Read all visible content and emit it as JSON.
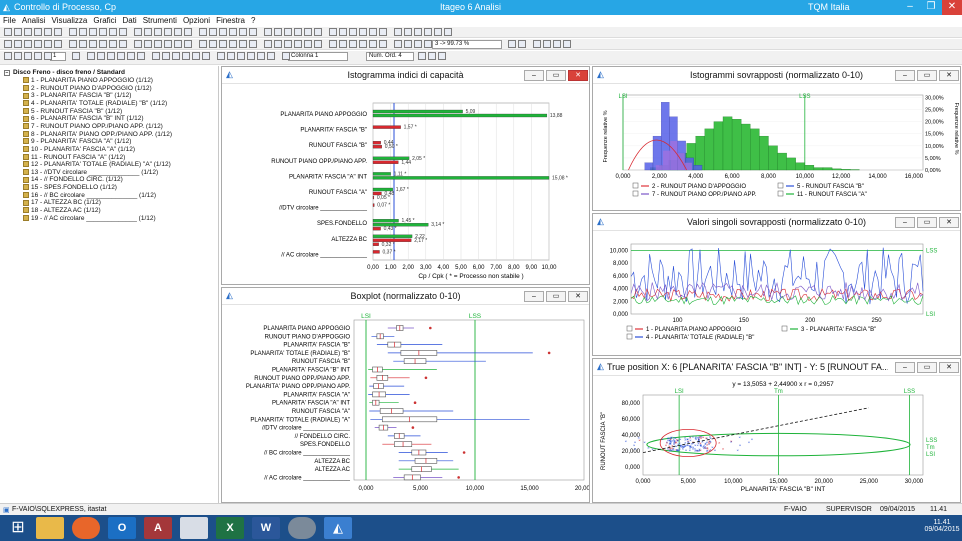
{
  "app": {
    "title_left": "Controllo di Processo, Cp",
    "title_center": "Itageo 6 Analisi",
    "title_right": "TQM Italia"
  },
  "menu": [
    "File",
    "Analisi",
    "Visualizza",
    "Grafici",
    "Dati",
    "Strumenti",
    "Opzioni",
    "Finestra",
    "?"
  ],
  "toolbar": {
    "combo_left": "1",
    "combo_colonna": "Colonna 1",
    "combo_num": "Num. Ord. 4",
    "combo_zoom": "3 -> 99.73 %"
  },
  "tree": {
    "root": "Disco Freno - disco freno / Standard",
    "items": [
      "1 - PLANARITA PIANO APPOGGIO (1/12)",
      "2 - RUNOUT PIANO D'APPOGGIO (1/12)",
      "3 - PLANARITA' FASCIA \"B\" (1/12)",
      "4 - PLANARITA' TOTALE (RADIALE) \"B\" (1/12)",
      "5 - RUNOUT FASCIA \"B\" (1/12)",
      "6 - PLANARITA' FASCIA \"B\" INT (1/12)",
      "7 - RUNOUT PIANO OPP./PIANO APP. (1/12)",
      "8 - PLANARITA' PIANO OPP./PIANO APP. (1/12)",
      "9 - PLANARITA' FASCIA \"A\" (1/12)",
      "10 - PLANARITA' FASCIA \"A\" (1/12)",
      "11 - RUNOUT FASCIA \"A\" (1/12)",
      "12 - PLANARITA' TOTALE (RADIALE) \"A\" (1/12)",
      "13 - //DTV circolare ______________ (1/12)",
      "14 - // FONDELLO CIRC. (1/12)",
      "15 - SPES.FONDELLO (1/12)",
      "16 - // BC circolare ______________ (1/12)",
      "17 - ALTEZZA BC (1/12)",
      "18 - ALTEZZA AC (1/12)",
      "19 - // AC circolare ______________ (1/12)"
    ]
  },
  "hist_cap": {
    "title": "Istogramma indici di capacità",
    "xlabel": "Cp / Cpk   ( * = Processo non stabile )",
    "ticks": [
      "0,00",
      "1,00",
      "2,00",
      "3,00",
      "4,00",
      "5,00",
      "6,00",
      "7,00",
      "8,00",
      "9,00",
      "10,00"
    ]
  },
  "boxplot": {
    "title": "Boxplot (normalizzato 0-10)",
    "lsi": "LSI",
    "lss": "LSS",
    "ticks": [
      "0,000",
      "5,000",
      "10,000",
      "15,000",
      "20,000"
    ]
  },
  "hist_over": {
    "title": "Istogrammi sovrapposti (normalizzato 0-10)",
    "lsi": "LSI",
    "lss": "LSS",
    "ylabel_left": "Frequenze relative %",
    "ylabel_right": "Frequenze relative %",
    "y_ticks": [
      "0,00%",
      "5,00%",
      "10,00%",
      "15,00%",
      "20,00%",
      "25,00%",
      "30,00%"
    ],
    "x_ticks": [
      "0,000",
      "2,000",
      "4,000",
      "6,000",
      "8,000",
      "10,000",
      "12,000",
      "14,000",
      "16,000"
    ],
    "legend": [
      "2 - RUNOUT PIANO D'APPOGGIO",
      "5 - RUNOUT FASCIA \"B\"",
      "7 - RUNOUT PIANO OPP./PIANO APP.",
      "11 - RUNOUT FASCIA \"A\""
    ],
    "colors": [
      "#e0333a",
      "#2a4fd8",
      "#7a56c8",
      "#1fb33a"
    ]
  },
  "values": {
    "title": "Valori singoli sovrapposti (normalizzato 0-10)",
    "lss": "LSS",
    "lsi": "LSI",
    "y_ticks": [
      "0,000",
      "2,000",
      "4,000",
      "6,000",
      "8,000",
      "10,000"
    ],
    "x_ticks": [
      "100",
      "150",
      "200",
      "250"
    ],
    "legend": [
      "1 - PLANARITA PIANO APPOGGIO",
      "3 - PLANARITA' FASCIA \"B\"",
      "4 - PLANARITA' TOTALE (RADIALE) \"B\""
    ],
    "colors": [
      "#e0333a",
      "#1fb33a",
      "#2a4fd8"
    ]
  },
  "scatter": {
    "title": "True position X: 6 [PLANARITA' FASCIA \"B\" INT] - Y: 5 [RUNOUT FA...",
    "equation": "y = 13,5053 + 2,44900 x   r = 0,2957",
    "xlabel": "PLANARITA' FASCIA \"B\" INT",
    "ylabel": "RUNOUT FASCIA \"B\"",
    "x_ticks": [
      "0,000",
      "5,000",
      "10,000",
      "15,000",
      "20,000",
      "25,000",
      "30,000"
    ],
    "y_ticks": [
      "0,000",
      "20,000",
      "40,000",
      "60,000",
      "80,000"
    ],
    "lsi": "LSI",
    "tm": "Tm",
    "lss": "LSS",
    "right_labels": [
      "LSS",
      "Tm",
      "LSI"
    ]
  },
  "status": {
    "path": "F-VAIO\\SQLEXPRESS, itastat",
    "pc": "F-VAIO",
    "user": "SUPERVISOR",
    "date": "09/04/2015",
    "time": "11.41"
  },
  "taskbar": {
    "time": "11.41",
    "date": "09/04/2015"
  }
}
